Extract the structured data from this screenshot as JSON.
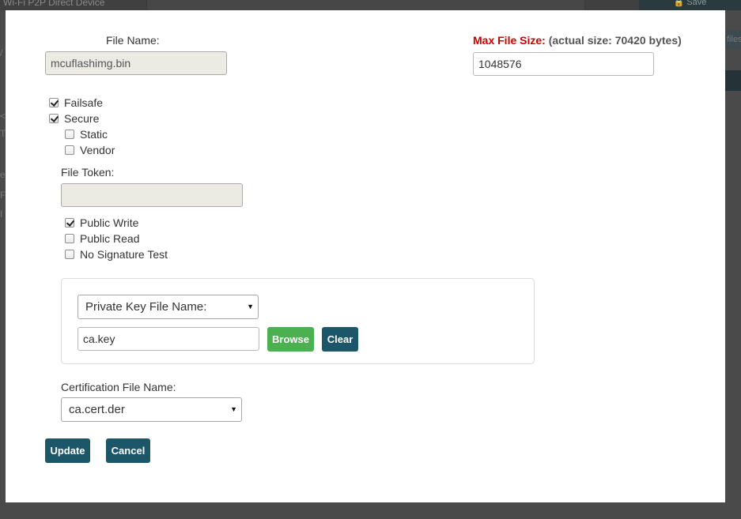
{
  "background": {
    "tab_text": "Wi-Fi P2P Direct Device",
    "save_label": "Save",
    "right_text": "files"
  },
  "form": {
    "file_name_label": "File Name:",
    "file_name_value": "mcuflashimg.bin",
    "max_size_label": "Max File Size:",
    "max_size_note": "(actual size: 70420 bytes)",
    "max_size_value": "1048576",
    "checkboxes": {
      "failsafe": {
        "label": "Failsafe",
        "checked": true
      },
      "secure": {
        "label": "Secure",
        "checked": true
      },
      "static": {
        "label": "Static",
        "checked": false
      },
      "vendor": {
        "label": "Vendor",
        "checked": false
      },
      "public_write": {
        "label": "Public Write",
        "checked": true
      },
      "public_read": {
        "label": "Public Read",
        "checked": false
      },
      "no_signature_test": {
        "label": "No Signature Test",
        "checked": false
      }
    },
    "file_token_label": "File Token:",
    "file_token_value": "",
    "key_type_select": "Private Key File Name:",
    "key_file_value": "ca.key",
    "browse_label": "Browse",
    "clear_label": "Clear",
    "cert_label": "Certification File Name:",
    "cert_select": "ca.cert.der",
    "update_label": "Update",
    "cancel_label": "Cancel"
  },
  "colors": {
    "accent_teal": "#1b5669",
    "browse_green": "#4caf50",
    "max_size_red": "#cc0000"
  }
}
